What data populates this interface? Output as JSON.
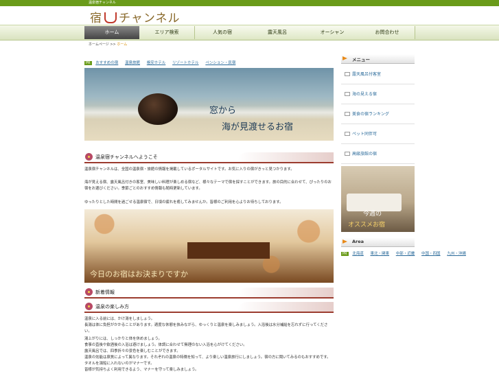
{
  "top_bar": {
    "text": "温泉宿チャンネル"
  },
  "logo": {
    "before": "宿",
    "after": "チャンネル",
    "icon": "hot-spring-icon"
  },
  "nav": {
    "items": [
      {
        "label": "ホーム",
        "active": true
      },
      {
        "label": "エリア検索",
        "active": false
      },
      {
        "label": "人気の宿",
        "active": false
      },
      {
        "label": "露天風呂",
        "active": false
      },
      {
        "label": "オーシャン",
        "active": false
      },
      {
        "label": "お問合わせ",
        "active": false
      }
    ]
  },
  "breadcrumb": {
    "home": "ホームページ",
    "sep": ">>",
    "current": "ホーム"
  },
  "pr_links": {
    "tag": "PR",
    "items": [
      "おすすめの宿",
      "温泉旅館",
      "格安ホテル",
      "リゾートホテル",
      "ペンション・民宿"
    ]
  },
  "banner1": {
    "line1": "窓から",
    "line2": "海が見渡せるお宿"
  },
  "section1": {
    "heading": "温泉宿チャンネルへようこそ",
    "p1": "温泉宿チャンネルは、全国の温泉宿・旅館の情報を掲載しているポータルサイトです。お気に入りの宿がきっと見つかります。",
    "p2": "海が見える宿、露天風呂付きの客室、美味しい料理が楽しめる宿など、様々なテーマで宿を探すことができます。旅の目的に合わせて、ぴったりのお宿をお選びください。季節ごとのおすすめ情報も随時更新しています。",
    "p3": "ゆったりとした時間を過ごせる温泉宿で、日頃の疲れを癒してみませんか。皆様のご利用を心よりお待ちしております。"
  },
  "banner2": {
    "text": "今日のお宿はお決まりですか"
  },
  "section2": {
    "heading": "新着情報"
  },
  "section3": {
    "heading": "温泉の楽しみ方",
    "lines": [
      "温泉に入る前には、かけ湯をしましょう。",
      "長湯は体に負担がかかることがあります。適度な休憩を挟みながら、ゆっくりと温泉を楽しみましょう。入浴後は水分補給を忘れずに行ってください。",
      "湯上がりには、しっかりと体を休めましょう。",
      "食事の直後や飲酒後の入浴は避けましょう。体調に合わせて無理のない入浴を心がけてください。",
      "露天風呂では、四季折々の景色を楽しむことができます。",
      "温泉の効能は泉質によって異なります。それぞれの温泉の特徴を知って、より楽しい温泉旅行にしましょう。宿の方に聞いてみるのもおすすめです。",
      "タオルを湯船に入れないのがマナーです。",
      "皆様が気持ちよく利用できるよう、マナーを守って楽しみましょう。"
    ]
  },
  "sidebar": {
    "menu_heading": "メニュー",
    "menu_items": [
      "露天風呂付客室",
      "海の見える宿",
      "美食の宿ランキング",
      "ペット同伴可",
      "高級旅館の宿"
    ],
    "feature": {
      "line1": "今週の",
      "line2": "オススメお宿"
    },
    "area_heading": "Area",
    "area_tag": "PR",
    "area_links": [
      "北海道",
      "東北・関東",
      "中部・近畿",
      "中国・四国",
      "九州・沖縄"
    ]
  }
}
